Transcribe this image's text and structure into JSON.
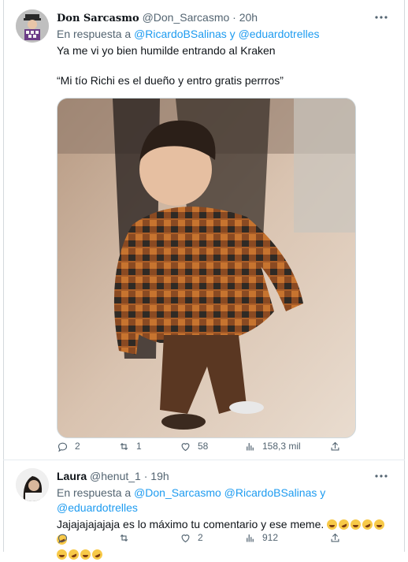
{
  "tweets": [
    {
      "display_name": "Don Sarcasmo",
      "handle": "@Don_Sarcasmo",
      "separator": "·",
      "time": "20h",
      "reply_prefix": "En respuesta a",
      "reply_mention_1": "@RicardoBSalinas",
      "reply_connector": "y",
      "reply_mention_2": "@eduardotrelles",
      "text_line_1": "Ya me vi yo bien humilde entrando al Kraken",
      "text_line_2": "“Mi tío Richi es el dueño y entro gratis perrros”",
      "actions": {
        "replies": "2",
        "retweets": "1",
        "likes": "58",
        "views": "158,3 mil"
      }
    },
    {
      "display_name": "Laura",
      "handle": "@henut_1",
      "separator": "·",
      "time": "19h",
      "reply_prefix": "En respuesta a",
      "reply_mention_1": "@Don_Sarcasmo",
      "reply_mention_2": "@RicardoBSalinas",
      "reply_connector": "y",
      "reply_mention_3": "@eduardotrelles",
      "text": "Jajajajajajaja es lo máximo tu comentario y ese meme.",
      "emoji_line_1_count": 6,
      "emoji_line_2_count": 4,
      "actions": {
        "replies": "",
        "retweets": "",
        "likes": "2",
        "views": "912"
      }
    }
  ],
  "icons": {
    "reply": "reply-icon",
    "retweet": "retweet-icon",
    "like": "heart-icon",
    "views": "views-icon",
    "share": "share-icon",
    "more": "more-icon"
  },
  "colors": {
    "link": "#1d9bf0",
    "secondary_text": "#536471",
    "primary_text": "#0f1419"
  }
}
